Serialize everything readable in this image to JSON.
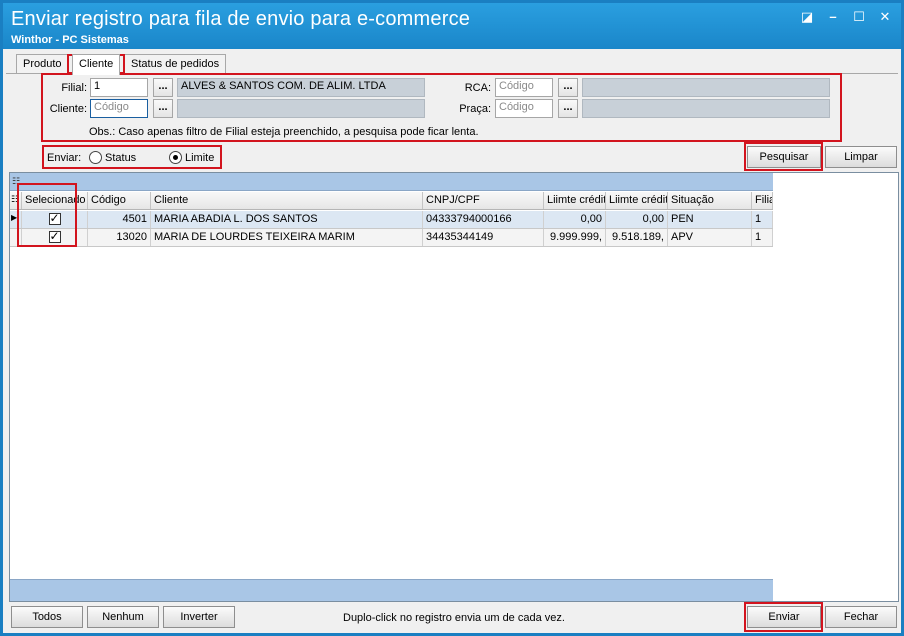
{
  "window": {
    "title": "Enviar registro para fila de envio para e-commerce",
    "subtitle": "Winthor - PC Sistemas"
  },
  "tabs": [
    {
      "label": "Produto"
    },
    {
      "label": "Cliente"
    },
    {
      "label": "Status de pedidos"
    }
  ],
  "filters": {
    "filial_label": "Filial:",
    "filial_value": "1",
    "filial_name": "ALVES & SANTOS COM. DE ALIM. LTDA",
    "cliente_label": "Cliente:",
    "cliente_placeholder": "Código",
    "rca_label": "RCA:",
    "rca_placeholder": "Código",
    "praca_label": "Praça:",
    "praca_placeholder": "Código",
    "dots": "...",
    "obs": "Obs.: Caso apenas filtro de Filial esteja preenchido, a pesquisa pode ficar lenta."
  },
  "enviar": {
    "label": "Enviar:",
    "options": [
      {
        "label": "Status",
        "selected": false
      },
      {
        "label": "Limite",
        "selected": true
      }
    ]
  },
  "actions": {
    "pesquisar": "Pesquisar",
    "limpar": "Limpar"
  },
  "grid": {
    "columns": [
      "Selecionado",
      "Código",
      "Cliente",
      "CNPJ/CPF",
      "Liimte crédit",
      "Liimte crédit",
      "Situação",
      "Filia"
    ],
    "rows": [
      {
        "selected": true,
        "codigo": "4501",
        "cliente": "MARIA ABADIA L. DOS SANTOS",
        "cnpj": "04333794000166",
        "limite1": "0,00",
        "limite2": "0,00",
        "situacao": "PEN",
        "filial": "1"
      },
      {
        "selected": true,
        "codigo": "13020",
        "cliente": "MARIA DE LOURDES TEIXEIRA MARIM",
        "cnpj": "34435344149",
        "limite1": "9.999.999,",
        "limite2": "9.518.189,",
        "situacao": "APV",
        "filial": "1"
      }
    ]
  },
  "footer": {
    "todos": "Todos",
    "nenhum": "Nenhum",
    "inverter": "Inverter",
    "hint": "Duplo-click no registro envia um de cada vez.",
    "enviar": "Enviar",
    "fechar": "Fechar"
  },
  "colors": {
    "titlebar": "#1e8ed1",
    "highlight": "#d2141e",
    "readonly_field": "#c8d0d8",
    "grid_band": "#a9c6e6"
  }
}
